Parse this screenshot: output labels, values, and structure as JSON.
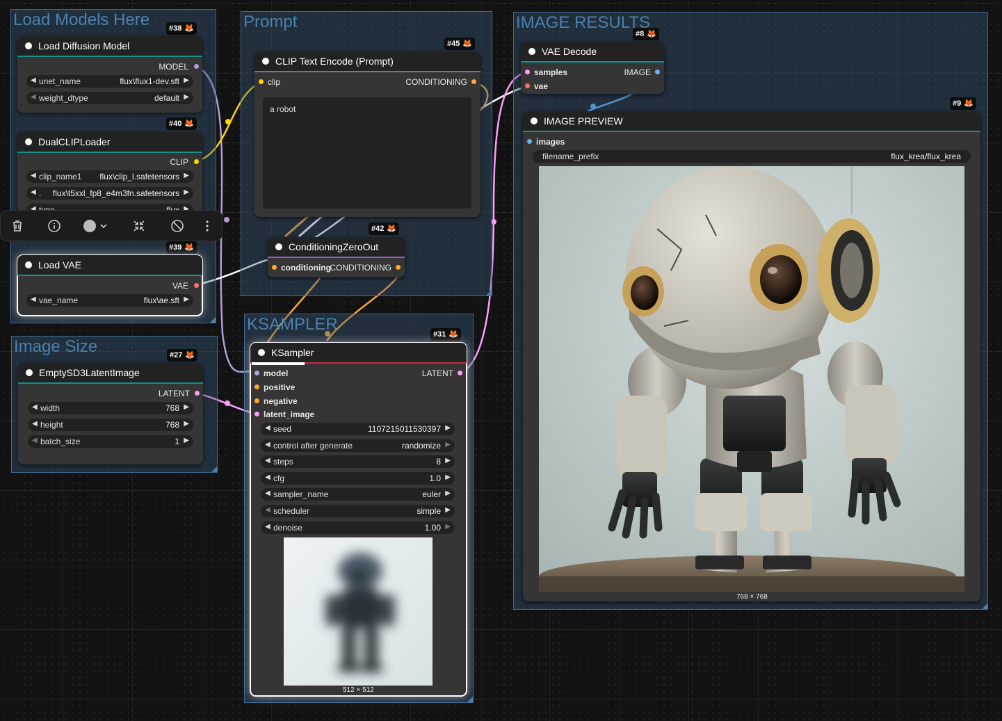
{
  "groups": {
    "load_models": "Load Models Here",
    "prompt": "Prompt",
    "image_results": "IMAGE RESULTS",
    "image_size": "Image Size",
    "ksampler": "KSAMPLER"
  },
  "nodes": {
    "load_diffusion": {
      "badge": "#38",
      "title": "Load Diffusion Model",
      "output": "MODEL",
      "widgets": [
        {
          "label": "unet_name",
          "value": "flux\\flux1-dev.sft"
        },
        {
          "label": "weight_dtype",
          "value": "default"
        }
      ]
    },
    "dual_clip": {
      "badge": "#40",
      "title": "DualCLIPLoader",
      "output": "CLIP",
      "widgets": [
        {
          "label": "clip_name1",
          "value": "flux\\clip_l.safetensors"
        },
        {
          "label": ".",
          "value": "flux\\t5xxl_fp8_e4m3fn.safetensors"
        },
        {
          "label": "type",
          "value": "flux"
        }
      ]
    },
    "load_vae": {
      "badge": "#39",
      "title": "Load VAE",
      "output": "VAE",
      "widgets": [
        {
          "label": "vae_name",
          "value": "flux\\ae.sft"
        }
      ]
    },
    "empty_latent": {
      "badge": "#27",
      "title": "EmptySD3LatentImage",
      "output": "LATENT",
      "widgets": [
        {
          "label": "width",
          "value": "768"
        },
        {
          "label": "height",
          "value": "768"
        },
        {
          "label": "batch_size",
          "value": "1"
        }
      ]
    },
    "clip_text": {
      "badge": "#45",
      "title": "CLIP Text Encode (Prompt)",
      "input": "clip",
      "output": "CONDITIONING",
      "text": "a robot"
    },
    "cond_zero": {
      "badge": "#42",
      "title": "ConditioningZeroOut",
      "input": "conditioning",
      "output": "CONDITIONING"
    },
    "ksampler": {
      "badge": "#31",
      "title": "KSampler",
      "inputs": [
        "model",
        "positive",
        "negative",
        "latent_image"
      ],
      "output": "LATENT",
      "widgets": [
        {
          "label": "seed",
          "value": "1107215011530397"
        },
        {
          "label": "control after generate",
          "value": "randomize"
        },
        {
          "label": "steps",
          "value": "8"
        },
        {
          "label": "cfg",
          "value": "1.0"
        },
        {
          "label": "sampler_name",
          "value": "euler"
        },
        {
          "label": "scheduler",
          "value": "simple"
        },
        {
          "label": "denoise",
          "value": "1.00"
        }
      ],
      "preview_size": "512 × 512"
    },
    "vae_decode": {
      "badge": "#8",
      "title": "VAE Decode",
      "inputs": [
        "samples",
        "vae"
      ],
      "output": "IMAGE"
    },
    "image_preview": {
      "badge": "#9",
      "title": "IMAGE PREVIEW",
      "input": "images",
      "widgets": [
        {
          "label": "filename_prefix",
          "value": "flux_krea/flux_krea"
        }
      ],
      "image_size": "768 × 768"
    }
  },
  "toolbar": {
    "icons": [
      "trash-icon",
      "info-icon",
      "color-circle-icon",
      "chevron-down-icon",
      "collapse-icon",
      "bypass-icon",
      "more-icon"
    ]
  },
  "colors": {
    "model": "#b39ddb",
    "clip": "#ffd500",
    "conditioning": "#ffa931",
    "latent": "#ff9cf9",
    "vae": "#ff6e6e",
    "image": "#64b5f6",
    "group": "#3d6a94",
    "header_accent": "#14928a"
  }
}
